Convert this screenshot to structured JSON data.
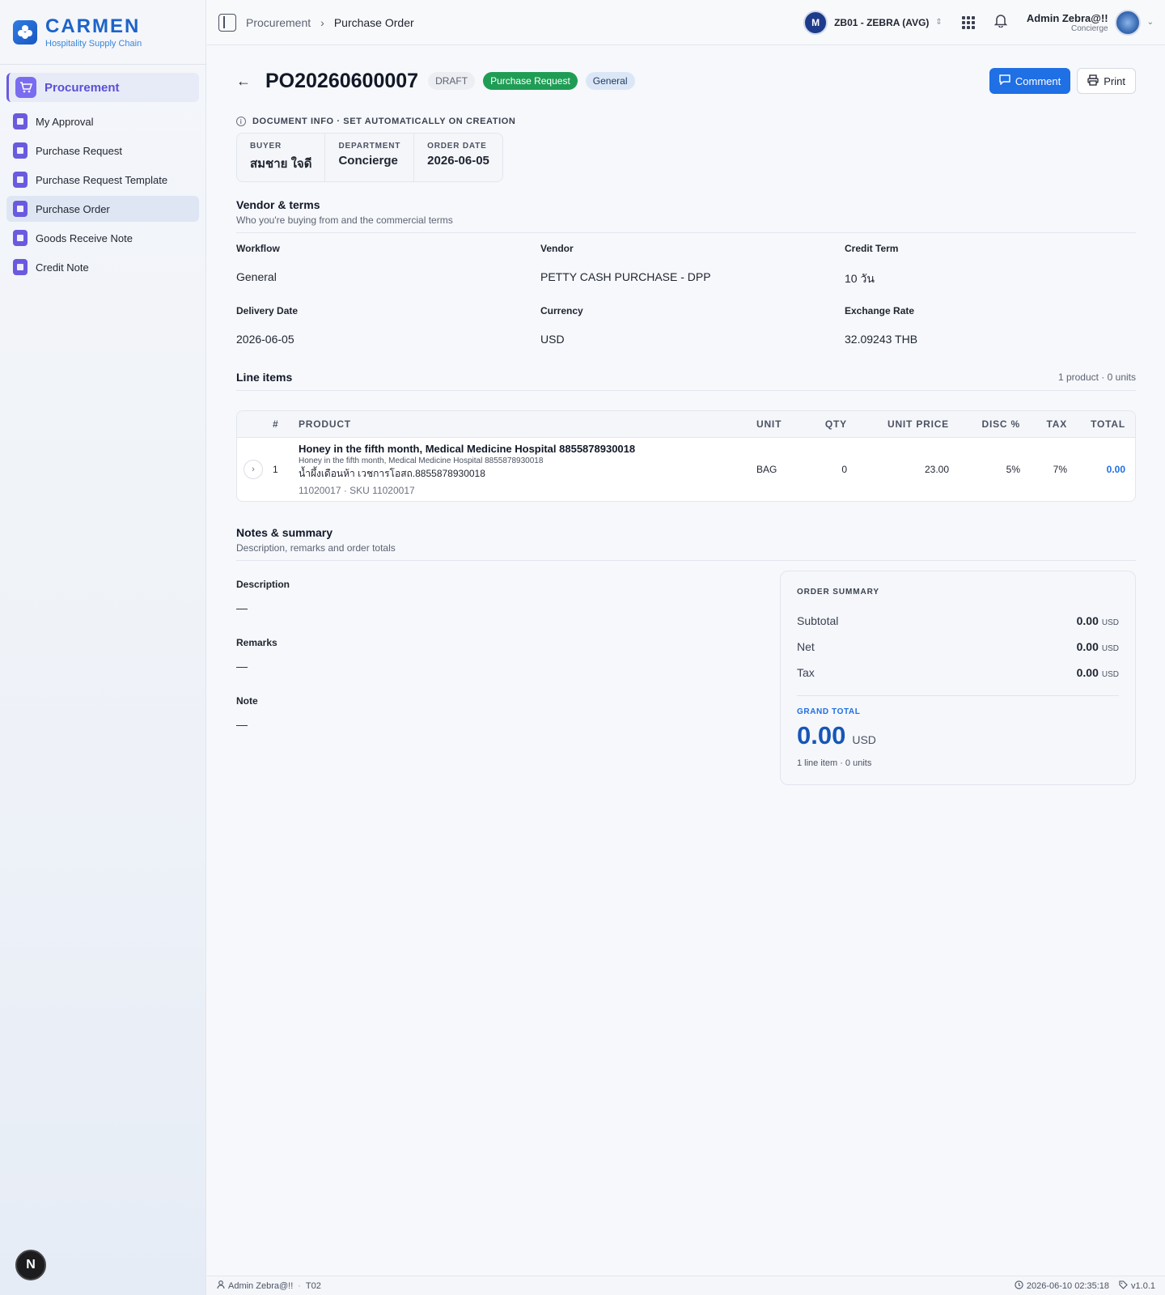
{
  "brand": {
    "name": "CARMEN",
    "subtitle": "Hospitality Supply Chain"
  },
  "sidebar": {
    "group_label": "Procurement",
    "items": [
      {
        "label": "My Approval"
      },
      {
        "label": "Purchase Request"
      },
      {
        "label": "Purchase Request Template"
      },
      {
        "label": "Purchase Order",
        "active": true
      },
      {
        "label": "Goods Receive Note"
      },
      {
        "label": "Credit Note"
      }
    ],
    "bottom_badge": "N"
  },
  "topbar": {
    "breadcrumb": [
      "Procurement",
      "Purchase Order"
    ],
    "org": "ZB01 - ZEBRA (AVG)",
    "org_initial": "M",
    "user_name": "Admin Zebra@!!",
    "user_role": "Concierge"
  },
  "header": {
    "po_number": "PO20260600007",
    "badges": {
      "status": "DRAFT",
      "source": "Purchase Request",
      "workflow": "General"
    },
    "comment_label": "Comment",
    "print_label": "Print"
  },
  "doc_info": {
    "label": "DOCUMENT INFO · SET AUTOMATICALLY ON CREATION",
    "buyer_label": "BUYER",
    "buyer": "สมชาย ใจดี",
    "department_label": "DEPARTMENT",
    "department": "Concierge",
    "order_date_label": "ORDER DATE",
    "order_date": "2026-06-05"
  },
  "vendor_terms": {
    "title": "Vendor & terms",
    "subtitle": "Who you're buying from and the commercial terms",
    "workflow_label": "Workflow",
    "workflow": "General",
    "vendor_label": "Vendor",
    "vendor": "PETTY CASH PURCHASE - DPP",
    "credit_term_label": "Credit Term",
    "credit_term": "10 วัน",
    "delivery_date_label": "Delivery Date",
    "delivery_date": "2026-06-05",
    "currency_label": "Currency",
    "currency": "USD",
    "exchange_rate_label": "Exchange Rate",
    "exchange_rate": "32.09243 THB"
  },
  "line_items": {
    "title": "Line items",
    "count": "1 product · 0 units",
    "headers": [
      "#",
      "PRODUCT",
      "UNIT",
      "QTY",
      "UNIT PRICE",
      "DISC %",
      "TAX",
      "TOTAL"
    ],
    "rows": [
      {
        "index": "1",
        "name": "Honey in the fifth month, Medical Medicine Hospital 8855878930018",
        "sub": "Honey in the fifth month, Medical Medicine Hospital 8855878930018",
        "local": "น้ำผึ้งเดือนห้า เวชการโอสถ.8855878930018",
        "sku": "11020017 · SKU 11020017",
        "unit": "BAG",
        "qty": "0",
        "unit_price": "23.00",
        "disc": "5%",
        "tax": "7%",
        "total": "0.00"
      }
    ]
  },
  "notes": {
    "title": "Notes & summary",
    "subtitle": "Description, remarks and order totals",
    "description_label": "Description",
    "description": "—",
    "remarks_label": "Remarks",
    "remarks": "—",
    "note_label": "Note",
    "note": "—"
  },
  "summary": {
    "title": "ORDER SUMMARY",
    "subtotal_label": "Subtotal",
    "subtotal": "0.00",
    "net_label": "Net",
    "net": "0.00",
    "tax_label": "Tax",
    "tax": "0.00",
    "currency": "USD",
    "grand_total_label": "GRAND TOTAL",
    "grand_total": "0.00",
    "meta": "1 line item · 0 units"
  },
  "footer": {
    "user": "Admin Zebra@!!",
    "code": "T02",
    "timestamp": "2026-06-10 02:35:18",
    "version": "v1.0.1"
  },
  "colors": {
    "accent": "#1f6fe5",
    "brand": "#1d63c9",
    "nav_accent": "#6a5ae0",
    "success": "#1f9d55"
  }
}
